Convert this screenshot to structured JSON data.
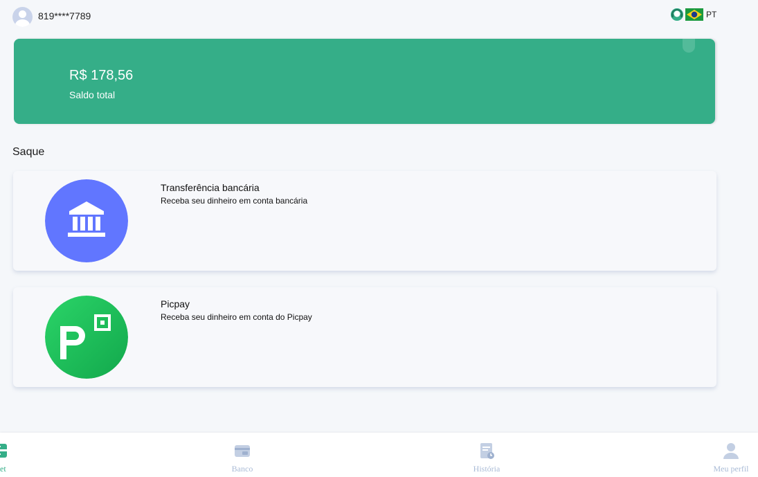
{
  "header": {
    "phone": "819****7789",
    "language": "PT"
  },
  "balance": {
    "amount": "R$ 178,56",
    "label": "Saldo total"
  },
  "section": {
    "title": "Saque"
  },
  "methods": [
    {
      "title": "Transferência bancária",
      "description": "Receba seu dinheiro em conta bancária",
      "icon": "bank-icon"
    },
    {
      "title": "Picpay",
      "description": "Receba seu dinheiro em conta do Picpay",
      "icon": "picpay-icon"
    }
  ],
  "nav": {
    "items": [
      {
        "label": "alet",
        "icon": "wallet-icon",
        "active": true
      },
      {
        "label": "Banco",
        "icon": "card-icon"
      },
      {
        "label": "História",
        "icon": "history-icon"
      },
      {
        "label": "Meu perfil",
        "icon": "user-icon"
      }
    ]
  },
  "colors": {
    "primary": "#35ae88",
    "bank_icon_bg": "#6176ff",
    "picpay_icon_bg": "#21c25e",
    "nav_inactive": "#a9bbd6"
  }
}
